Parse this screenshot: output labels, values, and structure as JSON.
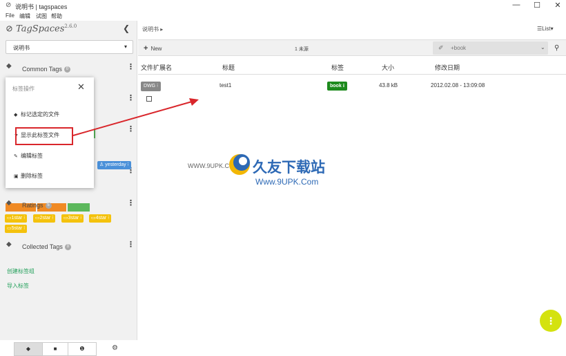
{
  "window": {
    "title": "说明书 | tagspaces",
    "minimize": "—",
    "maximize": "☐",
    "close": "✕"
  },
  "menu": {
    "items": [
      "File",
      "编辑",
      "试图",
      "帮助"
    ]
  },
  "sidebar": {
    "logo": "TagSpaces",
    "version": "2.6.0",
    "location": "说明书",
    "groups": [
      {
        "title": "Common Tags",
        "count": "0"
      },
      {
        "title": "Ratings",
        "count": "5"
      },
      {
        "title": "Collected Tags",
        "count": "0"
      }
    ],
    "blue_tag": "yesterday",
    "rating_tags": [
      "1star",
      "2star",
      "3star",
      "4star",
      "5star"
    ],
    "links": [
      "创建标签组",
      "导入标签"
    ]
  },
  "context_menu": {
    "header": "标签操作",
    "close": "✕",
    "items": [
      "标记选定的文件",
      "显示此标签文件",
      "编辑标签",
      "删除标签"
    ]
  },
  "main": {
    "breadcrumb": "说明书",
    "view_button": "List",
    "new_button": "New",
    "file_count": "1 未源",
    "search_placeholder": "+book",
    "columns": [
      "文件扩展名",
      "标题",
      "标签",
      "大小",
      "修改日期"
    ],
    "rows": [
      {
        "ext": "DWG",
        "title": "test1",
        "tag": "book",
        "size": "43.8 kB",
        "date": "2012.02.08 - 13:09:08"
      }
    ]
  },
  "watermark": {
    "site_cn": "久友下载站",
    "url": "Www.9UPK.Com",
    "left": "WWW.9UPK.COM"
  },
  "colors": {
    "accent": "#d4e20f",
    "tag_yellow": "#f4c20d",
    "tag_green": "#1d8a1d",
    "tag_blue": "#4a90d9",
    "arrow": "#d9262b"
  }
}
